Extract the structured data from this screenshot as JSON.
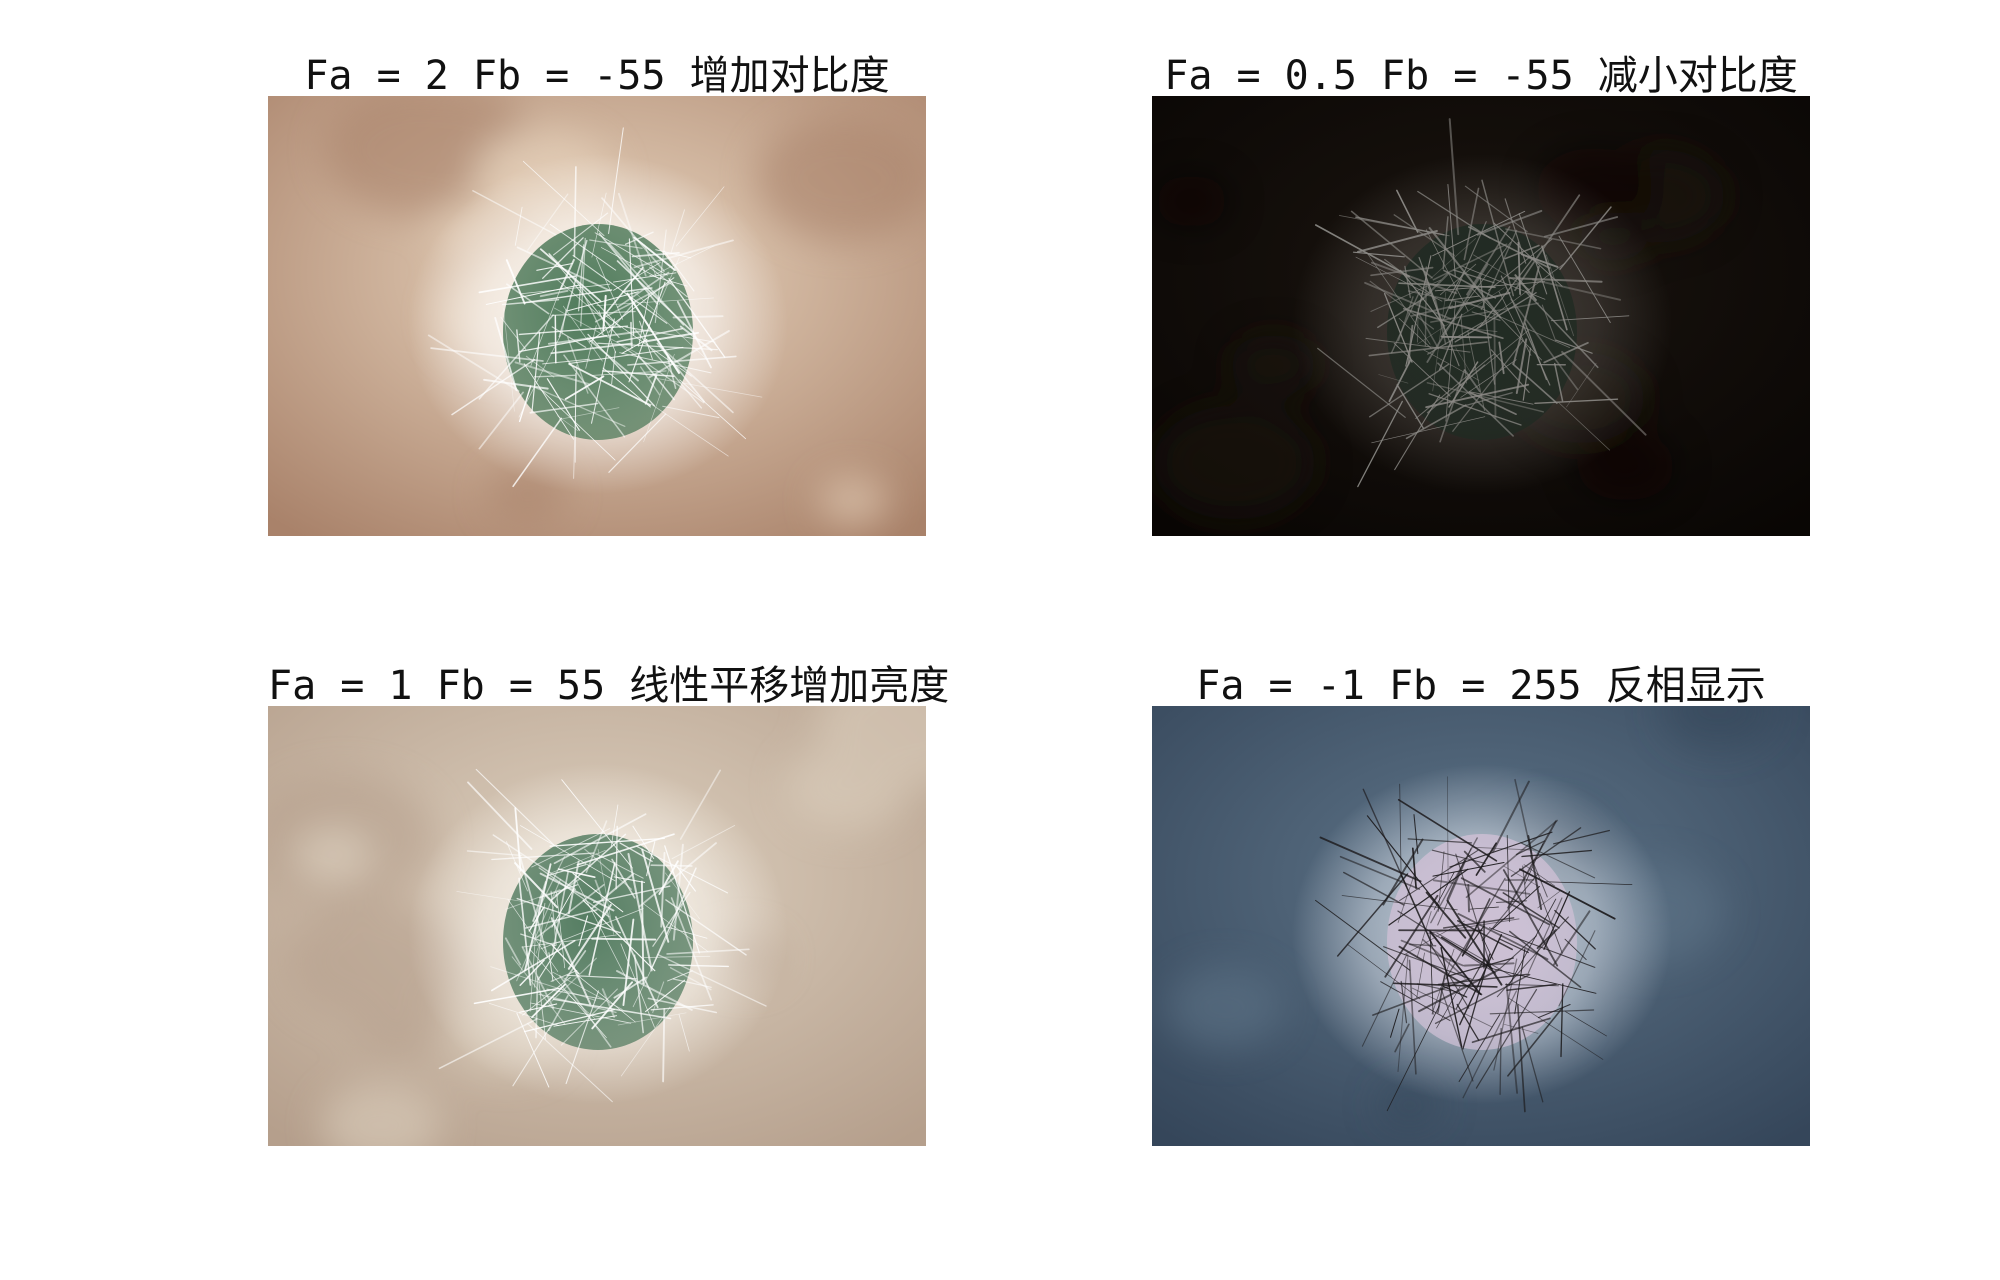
{
  "panels": [
    {
      "title": "Fa = 2 Fb = -55 增加对比度",
      "image": "cactus-high-contrast",
      "colors": {
        "bg": "#e9d6c0",
        "bgDark": "#a9826a",
        "glow": "#ffffff",
        "body": "#4f7a5a",
        "spine": "#ffffff"
      }
    },
    {
      "title": "Fa = 0.5 Fb = -55 减小对比度",
      "image": "cactus-low-contrast",
      "colors": {
        "bg": "#1a140f",
        "bgDark": "#090604",
        "glow": "#4a4540",
        "body": "#1f2a22",
        "spine": "#8c8a86"
      }
    },
    {
      "title": "Fa = 1 Fb = 55 线性平移增加亮度",
      "image": "cactus-brightened",
      "colors": {
        "bg": "#ddd0bf",
        "bgDark": "#b59f8c",
        "glow": "#fbf8f2",
        "body": "#557d62",
        "spine": "#ffffff"
      }
    },
    {
      "title": "Fa = -1 Fb = 255 反相显示",
      "image": "cactus-inverted",
      "colors": {
        "bg": "#5e7488",
        "bgDark": "#35465a",
        "glow": "#d5dce6",
        "body": "#cdbfd4",
        "spine": "#1c1a1c"
      }
    }
  ]
}
